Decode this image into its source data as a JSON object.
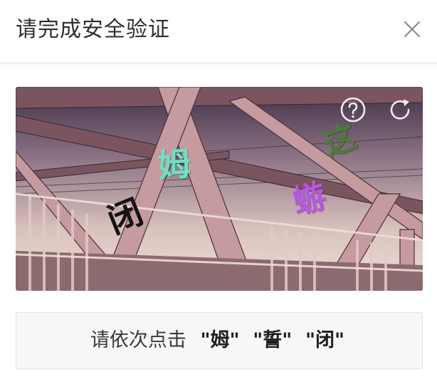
{
  "dialog": {
    "title": "请完成安全验证"
  },
  "captcha": {
    "glyphs": [
      {
        "char": "姆",
        "color": "#6fe0c4"
      },
      {
        "char": "这",
        "color": "#4e7a3c"
      },
      {
        "char": "蝣",
        "color": "#b659de"
      },
      {
        "char": "闭",
        "color": "#161214"
      }
    ],
    "instruction_prefix": "请依次点击",
    "targets": [
      "\"姆\"",
      "\"誓\"",
      "\"闭\""
    ]
  },
  "icons": {
    "close": "close-icon",
    "help": "question-circle-icon",
    "refresh": "refresh-icon"
  }
}
